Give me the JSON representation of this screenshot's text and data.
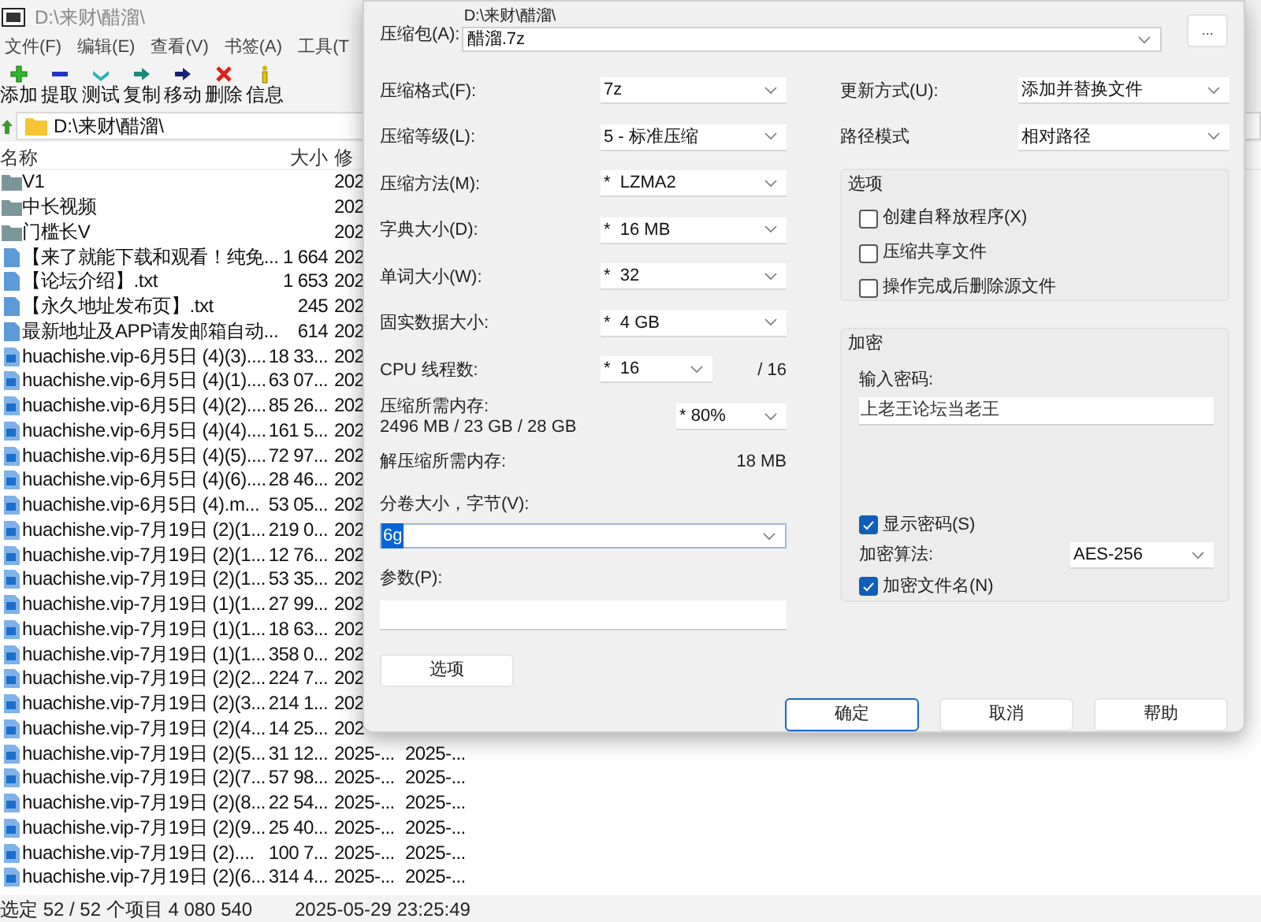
{
  "main_window": {
    "title": "D:\\来财\\醋溜\\",
    "menu": [
      "文件(F)",
      "编辑(E)",
      "查看(V)",
      "书签(A)",
      "工具(T"
    ],
    "toolbar": [
      {
        "label": "添加",
        "kind": "add"
      },
      {
        "label": "提取",
        "kind": "extract"
      },
      {
        "label": "测试",
        "kind": "test"
      },
      {
        "label": "复制",
        "kind": "copy"
      },
      {
        "label": "移动",
        "kind": "move"
      },
      {
        "label": "删除",
        "kind": "delete"
      },
      {
        "label": "信息",
        "kind": "info"
      }
    ],
    "path": "D:\\来财\\醋溜\\",
    "columns": [
      "名称",
      "大小",
      "修"
    ],
    "rows": [
      {
        "kind": "folder",
        "name": "V1",
        "modified": "202"
      },
      {
        "kind": "folder",
        "name": "中长视频",
        "modified": "202"
      },
      {
        "kind": "folder",
        "name": "门槛长V",
        "modified": "202"
      },
      {
        "kind": "document",
        "name": "【来了就能下载和观看！纯免...",
        "size": "1 664",
        "modified": "202"
      },
      {
        "kind": "document",
        "name": "【论坛介绍】.txt",
        "size": "1 653",
        "modified": "202"
      },
      {
        "kind": "document",
        "name": "【永久地址发布页】.txt",
        "size": "245",
        "modified": "202"
      },
      {
        "kind": "document",
        "name": "最新地址及APP请发邮箱自动...",
        "size": "614",
        "modified": "202"
      },
      {
        "kind": "media",
        "name": "huachishe.vip-6月5日 (4)(3)....",
        "size": "18 33...",
        "modified": "202"
      },
      {
        "kind": "media",
        "name": "huachishe.vip-6月5日 (4)(1)....",
        "size": "63 07...",
        "modified": "202"
      },
      {
        "kind": "media",
        "name": "huachishe.vip-6月5日 (4)(2)....",
        "size": "85 26...",
        "modified": "202"
      },
      {
        "kind": "media",
        "name": "huachishe.vip-6月5日 (4)(4)....",
        "size": "161 5...",
        "modified": "202"
      },
      {
        "kind": "media",
        "name": "huachishe.vip-6月5日 (4)(5)....",
        "size": "72 97...",
        "modified": "202"
      },
      {
        "kind": "media",
        "name": "huachishe.vip-6月5日 (4)(6)....",
        "size": "28 46...",
        "modified": "202"
      },
      {
        "kind": "media",
        "name": "huachishe.vip-6月5日 (4).m...",
        "size": "53 05...",
        "modified": "202"
      },
      {
        "kind": "media",
        "name": "huachishe.vip-7月19日 (2)(1...",
        "size": "219 0...",
        "modified": "202"
      },
      {
        "kind": "media",
        "name": "huachishe.vip-7月19日 (2)(1...",
        "size": "12 76...",
        "modified": "202"
      },
      {
        "kind": "media",
        "name": "huachishe.vip-7月19日 (2)(1...",
        "size": "53 35...",
        "modified": "202"
      },
      {
        "kind": "media",
        "name": "huachishe.vip-7月19日 (1)(1...",
        "size": "27 99...",
        "modified": "202"
      },
      {
        "kind": "media",
        "name": "huachishe.vip-7月19日 (1)(1...",
        "size": "18 63...",
        "modified": "202"
      },
      {
        "kind": "media",
        "name": "huachishe.vip-7月19日 (1)(1...",
        "size": "358 0...",
        "modified": "202"
      },
      {
        "kind": "media",
        "name": "huachishe.vip-7月19日 (2)(2...",
        "size": "224 7...",
        "modified": "202"
      },
      {
        "kind": "media",
        "name": "huachishe.vip-7月19日 (2)(3...",
        "size": "214 1...",
        "modified": "202"
      },
      {
        "kind": "media",
        "name": "huachishe.vip-7月19日 (2)(4...",
        "size": "14 25...",
        "modified": "202"
      },
      {
        "kind": "media",
        "name": "huachishe.vip-7月19日 (2)(5...",
        "size": "31 12...",
        "modified": "2025-...",
        "column_4": "2025-..."
      },
      {
        "kind": "media",
        "name": "huachishe.vip-7月19日 (2)(7...",
        "size": "57 98...",
        "modified": "2025-...",
        "column_4": "2025-..."
      },
      {
        "kind": "media",
        "name": "huachishe.vip-7月19日 (2)(8...",
        "size": "22 54...",
        "modified": "2025-...",
        "column_4": "2025-..."
      },
      {
        "kind": "media",
        "name": "huachishe.vip-7月19日 (2)(9...",
        "size": "25 40...",
        "modified": "2025-...",
        "column_4": "2025-..."
      },
      {
        "kind": "media",
        "name": "huachishe.vip-7月19日 (2)....",
        "size": "100 7...",
        "modified": "2025-...",
        "column_4": "2025-..."
      },
      {
        "kind": "media",
        "name": "huachishe.vip-7月19日 (2)(6...",
        "size": "314 4...",
        "modified": "2025-...",
        "column_4": "2025-..."
      }
    ],
    "status_bar": [
      "选定 52 / 52 个项目 4 080 540",
      "2025-05-29 23:25:49"
    ]
  },
  "dialog": {
    "archive": {
      "label": "压缩包(A):",
      "path": "D:\\来财\\醋溜\\",
      "value": "醋溜.7z",
      "browse": "..."
    },
    "settings": [
      {
        "label": "压缩格式(F):",
        "value": "7z"
      },
      {
        "label": "压缩等级(L):",
        "value": "5 - 标准压缩"
      },
      {
        "label": "压缩方法(M):",
        "value": "*  LZMA2"
      },
      {
        "label": "字典大小(D):",
        "value": "*  16 MB"
      },
      {
        "label": "单词大小(W):",
        "value": "*  32"
      },
      {
        "label": "固实数据大小:",
        "value": "*  4 GB"
      },
      {
        "label": "CPU 线程数:",
        "value": "*  16",
        "suffix": "/ 16"
      }
    ],
    "memory": {
      "label": "压缩所需内存:",
      "reading": "2496 MB / 23 GB / 28 GB",
      "value": "* 80%"
    },
    "decompress_memory": {
      "label": "解压缩所需内存:",
      "reading": "18 MB"
    },
    "volume": {
      "label": "分卷大小，字节(V):",
      "value": "6g",
      "selected": true
    },
    "parameters": {
      "label": "参数(P):"
    },
    "options_button": "选项",
    "update_mode": {
      "label": "更新方式(U):",
      "value": "添加并替换文件"
    },
    "path_mode": {
      "label": "路径模式",
      "value": "相对路径"
    },
    "options_group": {
      "title": "选项",
      "items": [
        {
          "label": "创建自释放程序(X)",
          "checked": false
        },
        {
          "label": "压缩共享文件",
          "checked": false
        },
        {
          "label": "操作完成后删除源文件",
          "checked": false
        }
      ]
    },
    "encryption": {
      "title": "加密",
      "password_label": "输入密码:",
      "password": "上老王论坛当老王",
      "show_password": {
        "label": "显示密码(S)",
        "checked": true
      },
      "method_label": "加密算法:",
      "method": "AES-256",
      "encrypt_names": {
        "label": "加密文件名(N)",
        "checked": true
      }
    },
    "buttons": [
      {
        "label": "确定",
        "default": true
      },
      {
        "label": "取消",
        "default": false
      },
      {
        "label": "帮助",
        "default": false
      }
    ]
  }
}
